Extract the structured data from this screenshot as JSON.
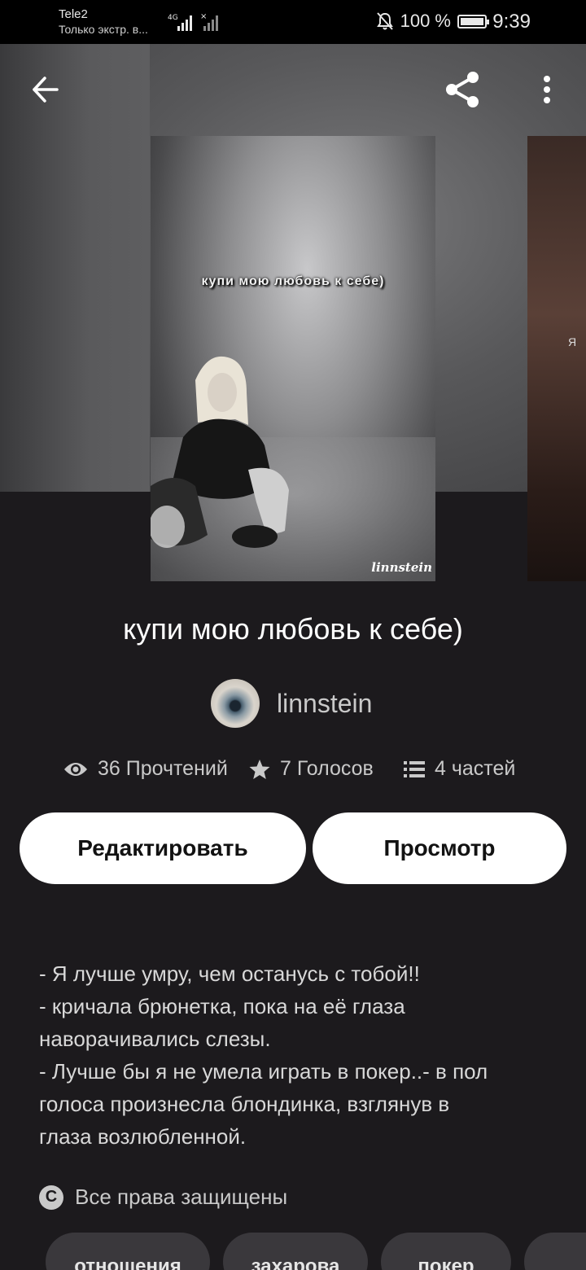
{
  "status_bar": {
    "carrier": "Tele2",
    "carrier_sub": "Только экстр. в...",
    "network": "4G",
    "battery": "100 %",
    "time": "9:39"
  },
  "toolbar": {
    "back_icon": "arrow-left-icon",
    "share_icon": "share-icon",
    "more_icon": "more-vertical-icon"
  },
  "cover": {
    "title_text": "купи мою любовь к себе)",
    "signature": "linnstein",
    "next_peek": "Я"
  },
  "story": {
    "title": "купи мою любовь к себе)",
    "author": "linnstein"
  },
  "stats": {
    "reads": "36 Прочтений",
    "votes": "7 Голосов",
    "parts": "4 частей"
  },
  "actions": {
    "edit": "Редактировать",
    "view": "Просмотр"
  },
  "description": [
    "- Я лучше умру, чем останусь с тобой!!",
    "- кричала брюнетка, пока на её глаза",
    "наворачивались слезы.",
    "- Лучше бы я не умела играть в покер..- в пол",
    "голоса произнесла блондинка, взглянув в",
    "глаза возлюбленной."
  ],
  "copyright": "Все права защищены",
  "tags": [
    "отношения",
    "захарова",
    "покер"
  ],
  "colors": {
    "background": "#1c1a1d",
    "button_bg": "#ffffff",
    "tag_bg": "#3a383c"
  }
}
